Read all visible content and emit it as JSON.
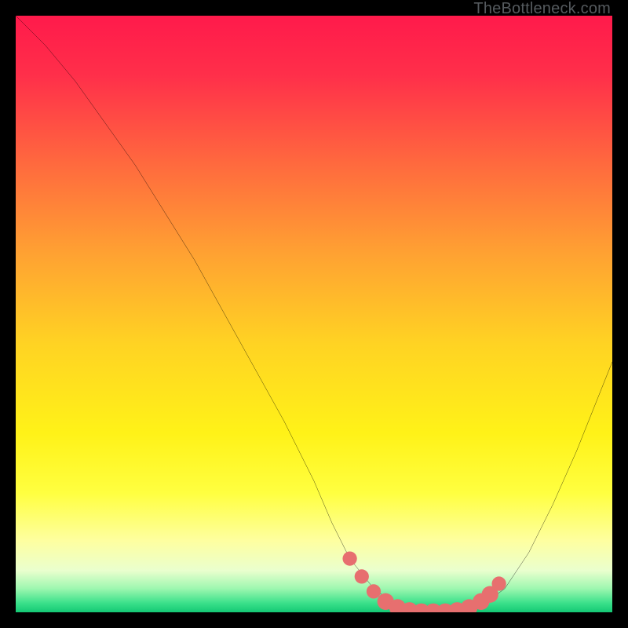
{
  "watermark": "TheBottleneck.com",
  "colors": {
    "frame": "#000000",
    "curve": "#000000",
    "markers": "#e76f6f",
    "gradient_stops": [
      {
        "offset": 0.0,
        "color": "#ff1a4b"
      },
      {
        "offset": 0.1,
        "color": "#ff2f4a"
      },
      {
        "offset": 0.25,
        "color": "#ff6a3e"
      },
      {
        "offset": 0.4,
        "color": "#ffa232"
      },
      {
        "offset": 0.55,
        "color": "#ffd323"
      },
      {
        "offset": 0.7,
        "color": "#fff218"
      },
      {
        "offset": 0.8,
        "color": "#ffff40"
      },
      {
        "offset": 0.88,
        "color": "#feffa0"
      },
      {
        "offset": 0.93,
        "color": "#eaffce"
      },
      {
        "offset": 0.96,
        "color": "#9ef7b0"
      },
      {
        "offset": 0.985,
        "color": "#39e08a"
      },
      {
        "offset": 1.0,
        "color": "#14c874"
      }
    ]
  },
  "chart_data": {
    "type": "line",
    "title": "",
    "xlabel": "",
    "ylabel": "",
    "xlim": [
      0,
      100
    ],
    "ylim": [
      0,
      100
    ],
    "series": [
      {
        "name": "bottleneck-curve",
        "x": [
          0,
          5,
          10,
          15,
          20,
          25,
          30,
          35,
          40,
          45,
          50,
          53,
          56,
          60,
          64,
          68,
          70,
          74,
          78,
          82,
          86,
          90,
          94,
          98,
          100
        ],
        "y": [
          100,
          95,
          89,
          82,
          75,
          67,
          59,
          50,
          41,
          32,
          22,
          15,
          9,
          4,
          1,
          0,
          0,
          0,
          1,
          4,
          10,
          18,
          27,
          37,
          42
        ]
      }
    ],
    "markers": [
      {
        "x": 56,
        "y": 9,
        "r": 1.2
      },
      {
        "x": 58,
        "y": 6,
        "r": 1.2
      },
      {
        "x": 60,
        "y": 3.5,
        "r": 1.2
      },
      {
        "x": 62,
        "y": 1.8,
        "r": 1.4
      },
      {
        "x": 64,
        "y": 0.8,
        "r": 1.4
      },
      {
        "x": 66,
        "y": 0.3,
        "r": 1.4
      },
      {
        "x": 68,
        "y": 0.1,
        "r": 1.4
      },
      {
        "x": 70,
        "y": 0.1,
        "r": 1.4
      },
      {
        "x": 72,
        "y": 0.1,
        "r": 1.4
      },
      {
        "x": 74,
        "y": 0.3,
        "r": 1.4
      },
      {
        "x": 76,
        "y": 0.8,
        "r": 1.4
      },
      {
        "x": 78,
        "y": 1.8,
        "r": 1.4
      },
      {
        "x": 79.5,
        "y": 3.0,
        "r": 1.4
      },
      {
        "x": 81,
        "y": 4.8,
        "r": 1.2
      }
    ]
  }
}
